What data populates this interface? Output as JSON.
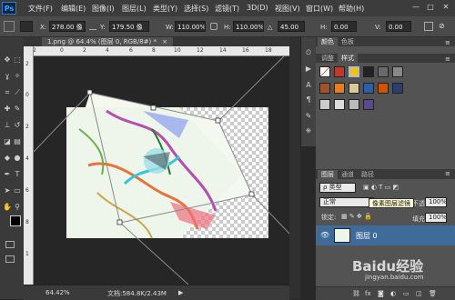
{
  "app": {
    "logo_text": "Ps"
  },
  "menu": {
    "items": [
      "文件(F)",
      "编辑(E)",
      "图像(I)",
      "图层(L)",
      "类型(Y)",
      "选择(S)",
      "滤镜(T)",
      "3D(D)",
      "视图(V)",
      "窗口(W)",
      "帮助(H)"
    ]
  },
  "window_controls": {
    "minimize": "—",
    "maximize": "□",
    "close": "✕"
  },
  "options": {
    "x_label": "X:",
    "x_value": "278.00 像",
    "y_label": "Y:",
    "y_value": "179.50 像",
    "w_label": "W:",
    "w_value": "110.00%",
    "h_label": "H:",
    "h_value": "110.00%",
    "angle_label": "△",
    "angle_value": "45.00",
    "h2_label": "H:",
    "h2_value": "0.00",
    "v_label": "V:",
    "v_value": "0.00"
  },
  "document": {
    "tab_title": "1.png @ 64.4% (图层 0, RGB/8#) *",
    "tab_close": "×"
  },
  "ruler": {
    "h_ticks": [
      "2",
      "0",
      "2",
      "4",
      "6",
      "8",
      "10",
      "12",
      "14",
      "16",
      "18"
    ],
    "v_ticks": [
      "2",
      "0",
      "2",
      "4",
      "6",
      "8",
      "1"
    ]
  },
  "status": {
    "zoom": "64.42%",
    "doc_info": "文档:584.8K/2.43M"
  },
  "panels": {
    "color_tabs": [
      "颜色",
      "色板"
    ],
    "style_tabs": [
      "调整",
      "样式"
    ],
    "layers_tabs": [
      "图层",
      "通道",
      "路径"
    ],
    "kind_filter": "ρ 类型",
    "blend_mode": "正常",
    "opacity_label": "不透明度:",
    "opacity_value": "100%",
    "lock_label": "锁定:",
    "fill_label": "填充:",
    "fill_value": "100%",
    "tooltip": "像素图层滤镜",
    "layer_name": "图层 0"
  },
  "watermark": {
    "brand": "Baidu经验",
    "url": "jingyan.baidu.com"
  },
  "colors": {
    "menubar": "#3c3c3c",
    "options": "#4a4a4a",
    "panel": "#535353",
    "layer_selected": "#3f6b9a"
  }
}
